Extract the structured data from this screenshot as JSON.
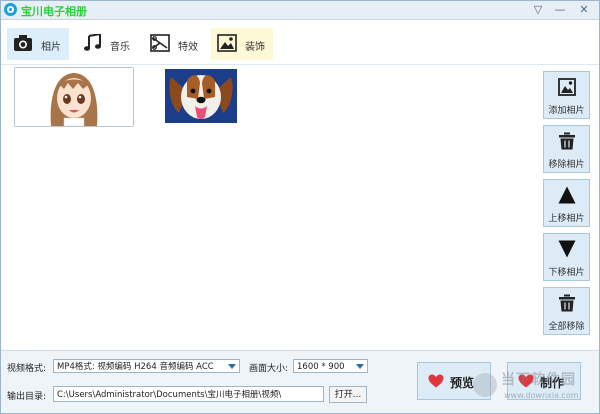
{
  "window": {
    "title": "宝川电子相册"
  },
  "tabs": [
    {
      "label": "相片",
      "icon": "camera-icon",
      "selected": true
    },
    {
      "label": "音乐",
      "icon": "music-note-icon"
    },
    {
      "label": "特效",
      "icon": "clapperboard-icon"
    },
    {
      "label": "装饰",
      "icon": "picture-icon"
    }
  ],
  "side_buttons": [
    {
      "label": "添加相片",
      "icon": "image-add-icon"
    },
    {
      "label": "移除相片",
      "icon": "trash-icon"
    },
    {
      "label": "上移相片",
      "icon": "arrow-up-icon"
    },
    {
      "label": "下移相片",
      "icon": "arrow-down-icon"
    },
    {
      "label": "全部移除",
      "icon": "trash-all-icon"
    }
  ],
  "settings": {
    "format_label": "视频格式:",
    "format_value": "MP4格式: 视频编码 H264 音频编码 ACC",
    "size_label": "画面大小:",
    "size_value": "1600 * 900",
    "output_label": "输出目录:",
    "output_value": "C:\\Users\\Administrator\\Documents\\宝川电子相册\\视频\\",
    "open_label": "打开..."
  },
  "actions": {
    "preview_label": "预览",
    "create_label": "制作"
  },
  "watermark": {
    "text": "当下软件园",
    "url": "www.downxia.com"
  },
  "colors": {
    "title_green": "#2bd13a",
    "accent_blue": "#dcebf6",
    "heart_red": "#e0373d"
  }
}
